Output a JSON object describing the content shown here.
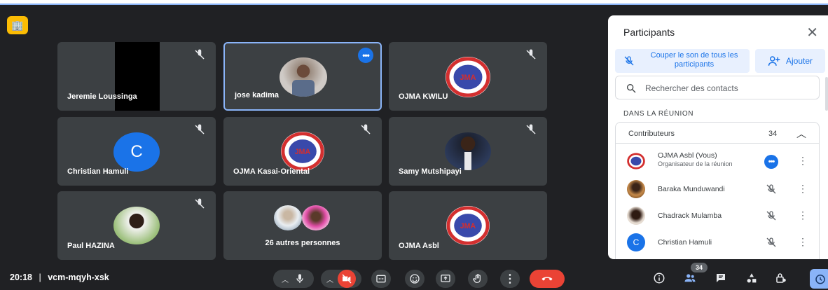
{
  "badge": {
    "label": "🏢"
  },
  "tiles": [
    {
      "name": "Jeremie Loussinga"
    },
    {
      "name": "jose kadima"
    },
    {
      "name": "OJMA KWILU"
    },
    {
      "name": "Christian Hamuli",
      "initial": "C"
    },
    {
      "name": "OJMA Kasai-Oriental"
    },
    {
      "name": "Samy Mutshipayi"
    },
    {
      "name": "Paul HAZINA"
    },
    {
      "name": "26 autres personnes"
    },
    {
      "name": "OJMA Asbl"
    }
  ],
  "logo_text": "JMA",
  "panel": {
    "title": "Participants",
    "close": "✕",
    "mute_all": "Couper le son de tous les participants",
    "add": "Ajouter",
    "search_placeholder": "Rechercher des contacts",
    "section": "DANS LA RÉUNION",
    "group_title": "Contributeurs",
    "group_count": "34",
    "participants": [
      {
        "name": "OJMA Asbl (Vous)",
        "sub": "Organisateur de la réunion"
      },
      {
        "name": "Baraka Munduwandi"
      },
      {
        "name": "Chadrack Mulamba"
      },
      {
        "name": "Christian Hamuli",
        "initial": "C"
      }
    ]
  },
  "bottom": {
    "time": "20:18",
    "separator": "|",
    "meeting_code": "vcm-mqyh-xsk",
    "participant_count": "34"
  },
  "colors": {
    "accent": "#1a73e8",
    "hangup": "#ea4335",
    "tile_bg": "#3c4043",
    "background": "#202124"
  }
}
